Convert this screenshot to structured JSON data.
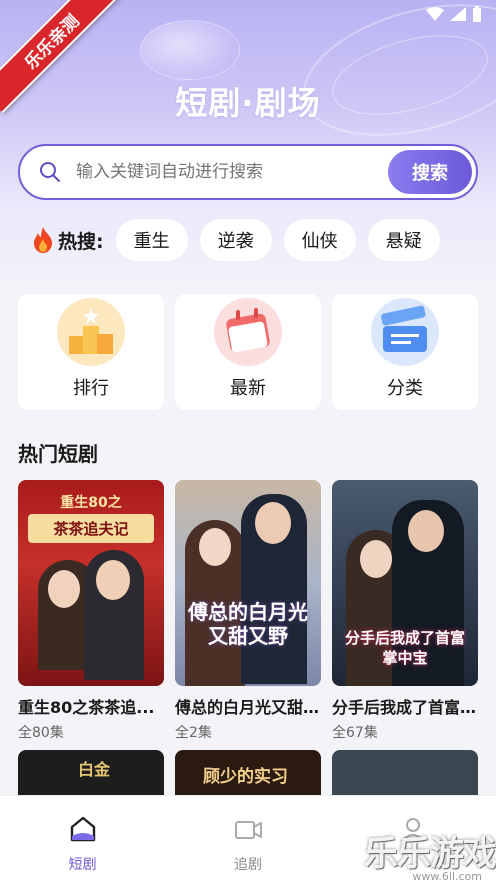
{
  "ribbon": "乐乐亲测",
  "header": {
    "title": "短剧·剧场"
  },
  "search": {
    "placeholder": "输入关键词自动进行搜索",
    "button_label": "搜索"
  },
  "hot_search": {
    "label": "热搜:",
    "tags": [
      "重生",
      "逆袭",
      "仙侠",
      "悬疑"
    ]
  },
  "categories": [
    {
      "label": "排行",
      "icon": "podium-icon"
    },
    {
      "label": "最新",
      "icon": "calendar-icon"
    },
    {
      "label": "分类",
      "icon": "clapperboard-icon"
    }
  ],
  "section": {
    "title": "热门短剧"
  },
  "dramas": [
    {
      "title": "重生80之茶茶追...",
      "count": "全80集",
      "poster_text": "茶茶追夫记",
      "poster_top": "重生80之"
    },
    {
      "title": "傅总的白月光又甜...",
      "count": "全2集",
      "poster_text": "傅总的白月光又甜又野"
    },
    {
      "title": "分手后我成了首富...",
      "count": "全67集",
      "poster_text": "分手后我成了首富掌中宝"
    }
  ],
  "dramas_row2_poster_text": [
    "白金",
    "顾少的实习",
    ""
  ],
  "tabbar": {
    "items": [
      {
        "label": "短剧",
        "active": true
      },
      {
        "label": "追剧",
        "active": false
      },
      {
        "label": "",
        "active": false
      }
    ]
  },
  "watermark": {
    "text": "乐乐游戏",
    "url": "www.6ll.com"
  },
  "colors": {
    "accent": "#6c5ad8",
    "ribbon": "#d9262a"
  }
}
